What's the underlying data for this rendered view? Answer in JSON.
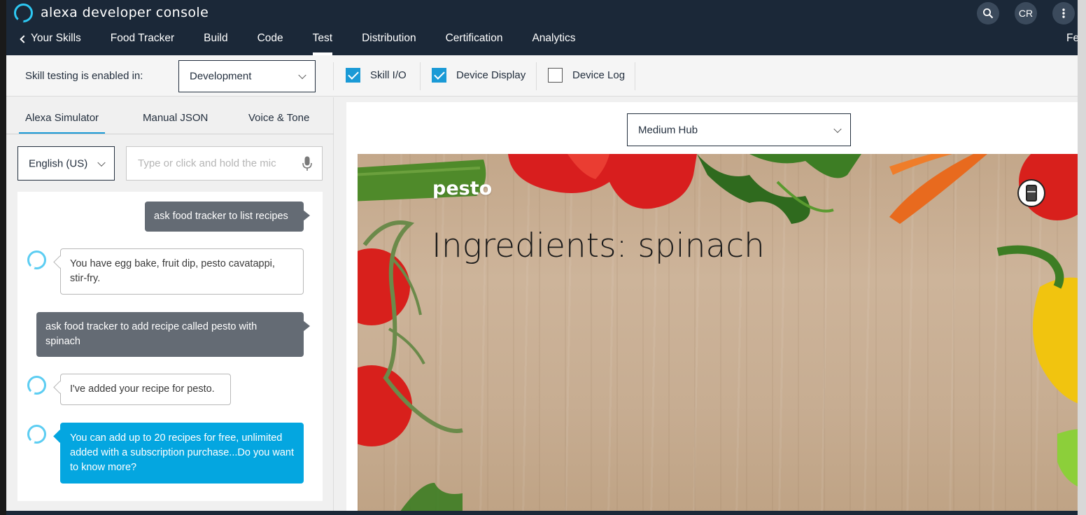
{
  "header": {
    "brand": "alexa developer console",
    "avatar_initials": "CR",
    "icons": [
      "search-icon",
      "more-vertical-icon"
    ]
  },
  "nav": {
    "back": "Your Skills",
    "items": [
      "Food Tracker",
      "Build",
      "Code",
      "Test",
      "Distribution",
      "Certification",
      "Analytics"
    ],
    "active": "Test",
    "right": "Feed"
  },
  "toolbar": {
    "label": "Skill testing is enabled in:",
    "stage": "Development",
    "checks": [
      {
        "label": "Skill I/O",
        "checked": true
      },
      {
        "label": "Device Display",
        "checked": true
      },
      {
        "label": "Device Log",
        "checked": false
      }
    ]
  },
  "simulator": {
    "tabs": [
      "Alexa Simulator",
      "Manual JSON",
      "Voice & Tone"
    ],
    "active_tab": "Alexa Simulator",
    "locale": "English (US)",
    "utterance_placeholder": "Type or click and hold the mic",
    "messages": [
      {
        "from": "user",
        "text": "ask food tracker to list recipes"
      },
      {
        "from": "alexa",
        "text": "You have egg bake, fruit dip, pesto cavatappi, stir-fry."
      },
      {
        "from": "user",
        "text": "ask food tracker to add recipe called pesto with spinach"
      },
      {
        "from": "alexa",
        "text": "I've added your recipe for pesto."
      },
      {
        "from": "alexa",
        "text": "You can add up to 20 recipes for free, unlimited added with a subscription purchase...Do you want to know more?",
        "highlighted": true
      }
    ]
  },
  "display": {
    "device": "Medium Hub",
    "title": "pesto",
    "body": "Ingredients: spinach"
  },
  "colors": {
    "header_bg": "#1b2838",
    "accent": "#1a9ad6",
    "alexa_blue": "#04a6e0",
    "user_bubble": "#646b74"
  }
}
